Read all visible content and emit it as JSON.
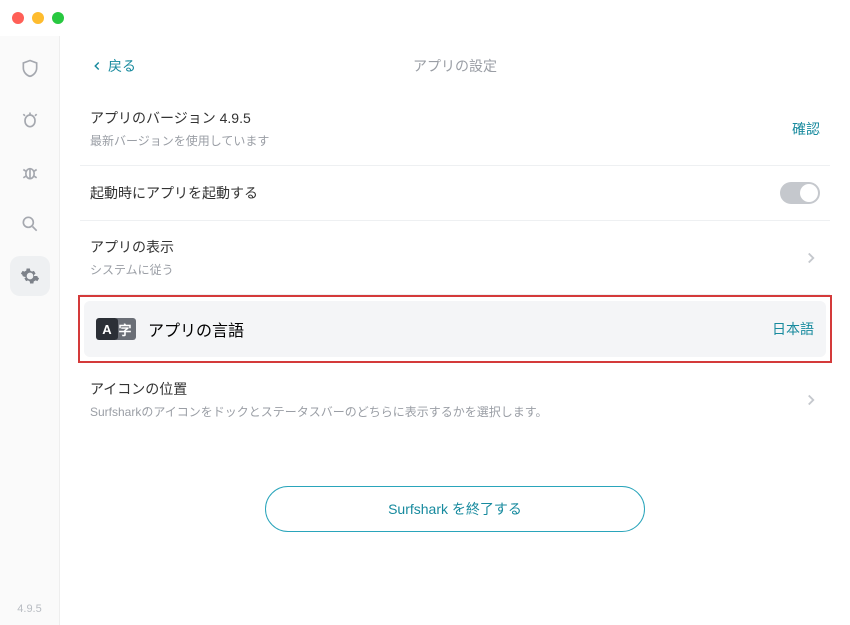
{
  "header": {
    "back_label": "戻る",
    "title": "アプリの設定"
  },
  "version_row": {
    "title": "アプリのバージョン 4.9.5",
    "subtitle": "最新バージョンを使用しています",
    "action": "確認"
  },
  "startup_row": {
    "title": "起動時にアプリを起動する"
  },
  "appearance_row": {
    "title": "アプリの表示",
    "subtitle": "システムに従う"
  },
  "language_row": {
    "title": "アプリの言語",
    "value": "日本語"
  },
  "icon_position_row": {
    "title": "アイコンの位置",
    "subtitle": "Surfsharkのアイコンをドックとステータスバーのどちらに表示するかを選択します。"
  },
  "quit_button": "Surfshark を終了する",
  "sidebar_version": "4.9.5"
}
